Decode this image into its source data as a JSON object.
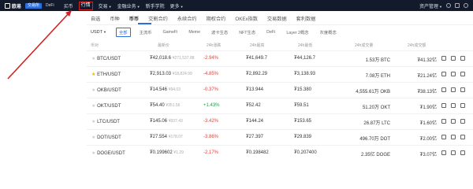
{
  "topbar": {
    "logo_text": "欧易",
    "mode_tabs": [
      "交易所",
      "DeFi"
    ],
    "nav": [
      "买币",
      "行情",
      "交易",
      "金融业务",
      "新手学院",
      "更多"
    ],
    "asset_manage": "资产管理"
  },
  "tabs_primary": [
    "自选",
    "币种",
    "币币",
    "交割合约",
    "永续合约",
    "期权合约",
    "OKEx指数",
    "交易数据",
    "套利数据"
  ],
  "quote_currency": "USDT",
  "tabs_secondary": [
    "全部",
    "主流币",
    "GameFi",
    "Meme",
    "波卡生态",
    "NFT生态",
    "DeFi",
    "Layer 2概念",
    "灰度概念"
  ],
  "table": {
    "headers": [
      "币对",
      "最新价",
      "24h涨跌",
      "24h最高",
      "24h最低",
      "24h成交量",
      "24h成交额"
    ],
    "rows": [
      {
        "pair": "BTC/USDT",
        "star": false,
        "price": "₮42,018.6",
        "sub": "¥271,537.88",
        "change": "-2.94%",
        "dir": "down",
        "high": "₮41,649.7",
        "low": "₮44,126.7",
        "vol": "1.53万 BTC",
        "amt": "₮41.32亿"
      },
      {
        "pair": "ETH/USDT",
        "star": true,
        "price": "₮2,913.03",
        "sub": "¥18,824.99",
        "change": "-4.85%",
        "dir": "down",
        "high": "₮2,892.29",
        "low": "₮3,138.93",
        "vol": "7.08万 ETH",
        "amt": "₮21.24亿"
      },
      {
        "pair": "OKB/USDT",
        "star": false,
        "price": "₮14.546",
        "sub": "¥94.03",
        "change": "-0.37%",
        "dir": "down",
        "high": "₮13.944",
        "low": "₮15.380",
        "vol": "4,555.61万 OKB",
        "amt": "₮38.13亿"
      },
      {
        "pair": "OKT/USDT",
        "star": false,
        "price": "₮54.40",
        "sub": "¥351.56",
        "change": "+1.43%",
        "dir": "up",
        "high": "₮52.42",
        "low": "₮59.51",
        "vol": "51.20万 OKT",
        "amt": "₮1.90亿"
      },
      {
        "pair": "LTC/USDT",
        "star": false,
        "price": "₮145.06",
        "sub": "¥937.43",
        "change": "-3.42%",
        "dir": "down",
        "high": "₮144.24",
        "low": "₮153.65",
        "vol": "26.87万 LTC",
        "amt": "₮1.60亿"
      },
      {
        "pair": "DOT/USDT",
        "star": false,
        "price": "₮27.554",
        "sub": "¥178.07",
        "change": "-3.86%",
        "dir": "down",
        "high": "₮27.397",
        "low": "₮29.839",
        "vol": "496.70万 DOT",
        "amt": "₮2.00亿"
      },
      {
        "pair": "DOGE/USDT",
        "star": false,
        "price": "₮0.199602",
        "sub": "¥1.29",
        "change": "-2.17%",
        "dir": "down",
        "high": "₮0.198482",
        "low": "₮0.207400",
        "vol": "2.35亿 DOGE",
        "amt": "₮3.07亿"
      }
    ]
  },
  "colors": {
    "topbar_bg": "#121a2c",
    "accent": "#2a6fdc",
    "up": "#16a34a",
    "down": "#e0443c",
    "highlight": "#d32020"
  },
  "icons": [
    "logo-icon",
    "globe-icon",
    "download-icon",
    "user-icon",
    "favorite-star-icon",
    "chart-icon",
    "trade-icon",
    "alert-icon"
  ]
}
